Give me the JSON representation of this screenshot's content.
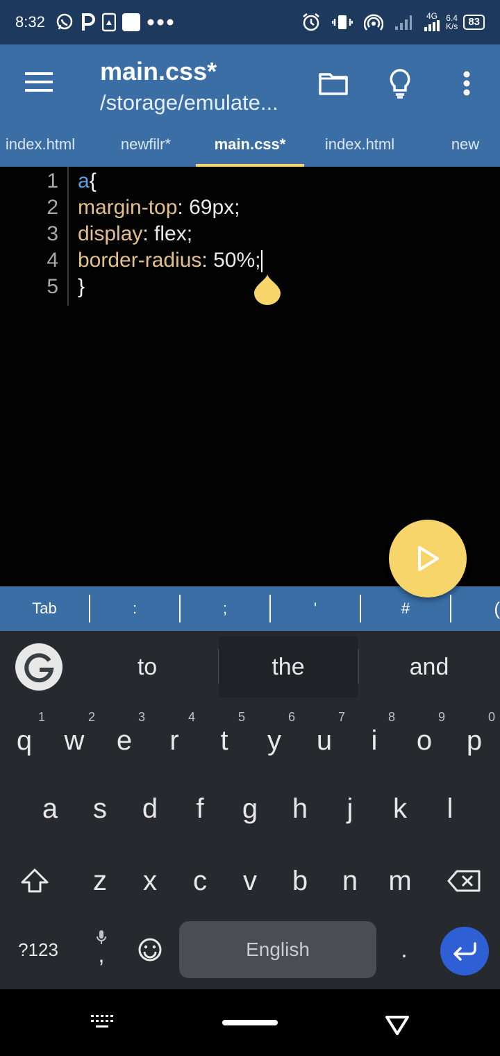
{
  "status_bar": {
    "time": "8:32",
    "network_type": "4G",
    "speed_value": "6.4",
    "speed_unit": "K/s",
    "battery": "83"
  },
  "app_bar": {
    "title": "main.css*",
    "subtitle": "/storage/emulate..."
  },
  "tabs": [
    {
      "label": "index.html"
    },
    {
      "label": "newfilr*"
    },
    {
      "label": "main.css*",
      "active": true
    },
    {
      "label": "index.html"
    },
    {
      "label": "new"
    }
  ],
  "editor": {
    "line_numbers": [
      "1",
      "2",
      "3",
      "4",
      "5"
    ],
    "lines": {
      "l1_selector": "a",
      "l1_brace": "{",
      "l2_prop": "margin-top",
      "l2_value": ": 69px;",
      "l3_prop": "display",
      "l3_value": ": flex;",
      "l4_prop": "border-radius",
      "l4_value": ": 50%;",
      "l5_brace": "}"
    }
  },
  "symbol_bar": [
    "Tab",
    ":",
    ";",
    "'",
    "#",
    "("
  ],
  "keyboard": {
    "suggestions": [
      "to",
      "the",
      "and"
    ],
    "row1": [
      "q",
      "w",
      "e",
      "r",
      "t",
      "y",
      "u",
      "i",
      "o",
      "p"
    ],
    "row1_hints": [
      "1",
      "2",
      "3",
      "4",
      "5",
      "6",
      "7",
      "8",
      "9",
      "0"
    ],
    "row2": [
      "a",
      "s",
      "d",
      "f",
      "g",
      "h",
      "j",
      "k",
      "l"
    ],
    "row3": [
      "z",
      "x",
      "c",
      "v",
      "b",
      "n",
      "m"
    ],
    "symbols_key": "?123",
    "comma": ",",
    "period": ".",
    "space_label": "English"
  },
  "colors": {
    "app_bar": "#3a6ea5",
    "status_bar": "#1d3a5e",
    "accent": "#f7d56b",
    "selector": "#5aa0e0",
    "property": "#e2c08d"
  }
}
